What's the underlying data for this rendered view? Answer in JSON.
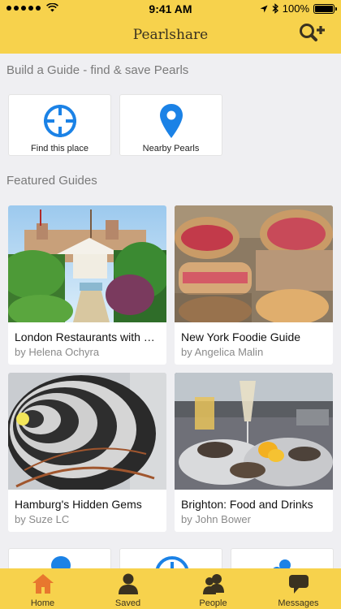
{
  "status_bar": {
    "time": "9:41 AM",
    "battery": "100%"
  },
  "header": {
    "title": "Pearlshare",
    "action_icon": "add-person-icon"
  },
  "build_section": {
    "title": "Build a Guide - find & save Pearls",
    "tiles": [
      {
        "label": "Find this place",
        "icon": "crosshair-icon"
      },
      {
        "label": "Nearby Pearls",
        "icon": "map-pin-icon"
      }
    ]
  },
  "featured_section": {
    "title": "Featured Guides",
    "guides": [
      {
        "title": "London Restaurants with Gardens",
        "author": "by Helena Ochyra"
      },
      {
        "title": "New York Foodie Guide",
        "author": "by Angelica Malin"
      },
      {
        "title": "Hamburg's Hidden Gems",
        "author": "by Suze LC"
      },
      {
        "title": "Brighton: Food and Drinks",
        "author": "by John Bower"
      }
    ]
  },
  "tab_bar": {
    "tabs": [
      {
        "label": "Home",
        "icon": "home-icon",
        "active": true
      },
      {
        "label": "Saved",
        "icon": "person-icon"
      },
      {
        "label": "People",
        "icon": "people-icon"
      },
      {
        "label": "Messages",
        "icon": "chat-bubble-icon"
      }
    ]
  },
  "colors": {
    "brand_yellow": "#f7d24c",
    "accent_blue": "#1b82e6",
    "active_tab": "#e8772e"
  }
}
